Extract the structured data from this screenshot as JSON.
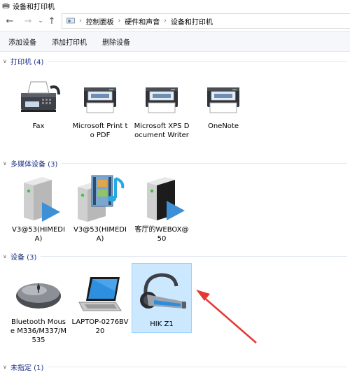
{
  "window": {
    "title": "设备和打印机"
  },
  "nav": {
    "back": "←",
    "forward": "→",
    "recent": "⌄",
    "up": "↑"
  },
  "breadcrumb": {
    "items": [
      "控制面板",
      "硬件和声音",
      "设备和打印机"
    ],
    "separator": "›"
  },
  "commands": [
    "添加设备",
    "添加打印机",
    "删除设备"
  ],
  "groups": {
    "printers": {
      "label": "打印机 (4)"
    },
    "multimedia": {
      "label": "多媒体设备 (3)"
    },
    "devices": {
      "label": "设备 (3)"
    },
    "unspecified": {
      "label": "未指定 (1)"
    }
  },
  "printers": [
    {
      "label": "Fax",
      "icon": "fax-icon"
    },
    {
      "label": "Microsoft Print to PDF",
      "icon": "printer-icon"
    },
    {
      "label": "Microsoft XPS Document Writer",
      "icon": "printer-icon"
    },
    {
      "label": "OneNote",
      "icon": "printer-icon"
    }
  ],
  "multimedia": [
    {
      "label": "V3@53(HIMEDIA)",
      "icon": "media-server-play-icon"
    },
    {
      "label": "V3@53(HIMEDIA)",
      "icon": "media-server-music-icon"
    },
    {
      "label": "客厅的WEBOX@50",
      "icon": "media-renderer-black-icon"
    }
  ],
  "devices": [
    {
      "label": "Bluetooth Mouse M336/M337/M535",
      "icon": "mouse-icon"
    },
    {
      "label": "LAPTOP-0276BV20",
      "icon": "laptop-icon"
    },
    {
      "label": "HIK Z1",
      "icon": "headset-icon",
      "selected": true
    }
  ],
  "colors": {
    "accent": "#1e3287",
    "selection": "#cce8ff",
    "annotation_arrow": "#e53935"
  }
}
